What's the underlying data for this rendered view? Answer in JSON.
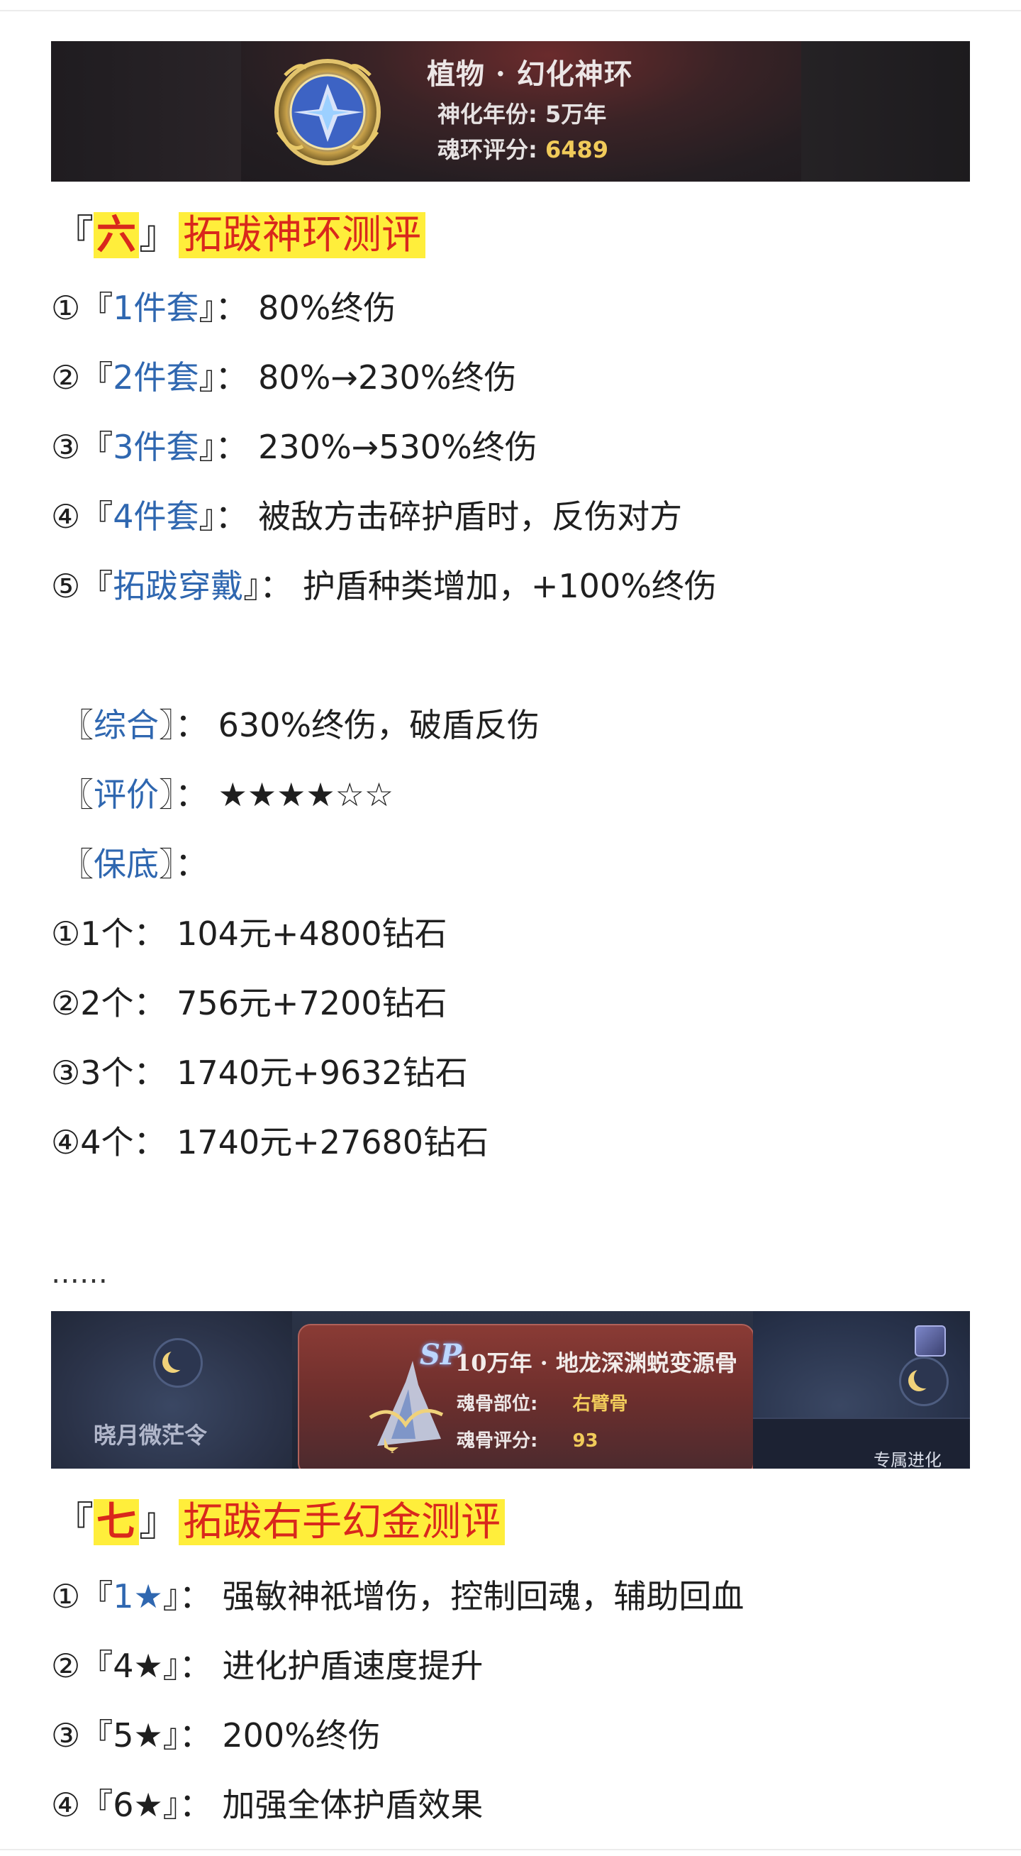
{
  "banner1": {
    "title": "植物 · 幻化神环",
    "year_label": "神化年份:",
    "year_value": "5万年",
    "score_label": "魂环评分:",
    "score_value": "6489"
  },
  "section6": {
    "bracket_open": "『",
    "num": "六",
    "bracket_close": "』",
    "title": "拓跋神环测评",
    "items": [
      {
        "marker": "①",
        "open": "『",
        "label": "1件套",
        "close": "』",
        "text": "：  80%终伤"
      },
      {
        "marker": "②",
        "open": "『",
        "label": "2件套",
        "close": "』",
        "text": "：  80%→230%终伤"
      },
      {
        "marker": "③",
        "open": "『",
        "label": "3件套",
        "close": "』",
        "text": "：  230%→530%终伤"
      },
      {
        "marker": "④",
        "open": "『",
        "label": "4件套",
        "close": "』",
        "text": "：  被敌方击碎护盾时，反伤对方"
      },
      {
        "marker": "⑤",
        "open": "『",
        "label": "拓跋穿戴",
        "close": "』",
        "text": "：  护盾种类增加，+100%终伤"
      }
    ],
    "summary": [
      {
        "open": "〖",
        "label": "综合",
        "close": "〗",
        "text": "：  630%终伤，破盾反伤"
      },
      {
        "open": "〖",
        "label": "评价",
        "close": "〗",
        "text": "：  ★★★★☆☆"
      },
      {
        "open": "〖",
        "label": "保底",
        "close": "〗",
        "text": "："
      }
    ],
    "guarantees": [
      "①1个：  104元+4800钻石",
      "②2个：  756元+7200钻石",
      "③3个：  1740元+9632钻石",
      "④4个：  1740元+27680钻石"
    ]
  },
  "ellipsis": "……",
  "banner2": {
    "left_label": "晓月微茫令",
    "sp": "SP",
    "title": "10万年 · 地龙深渊蜕变源骨",
    "part_label": "魂骨部位:",
    "part_value": "右臂骨",
    "score_label": "魂骨评分:",
    "score_value": "93",
    "bottom_right": "专属进化"
  },
  "section7": {
    "bracket_open": "『",
    "num": "七",
    "bracket_close": "』",
    "title": "拓跋右手幻金测评",
    "items": [
      {
        "marker": "①",
        "open": "『",
        "label": "1★",
        "close": "』",
        "text": "：  强敏神祇增伤，控制回魂，辅助回血"
      },
      {
        "marker": "②",
        "open": "『",
        "label": "4★",
        "close": "』",
        "text": "：  进化护盾速度提升"
      },
      {
        "marker": "③",
        "open": "『",
        "label": "5★",
        "close": "』",
        "text": "：  200%终伤"
      },
      {
        "marker": "④",
        "open": "『",
        "label": "6★",
        "close": "』",
        "text": "：  加强全体护盾效果"
      }
    ]
  },
  "colors": {
    "highlight": "#ffee3b",
    "red": "#d9281c",
    "blue": "#2f67b0",
    "gold": "#f1cb5a"
  }
}
